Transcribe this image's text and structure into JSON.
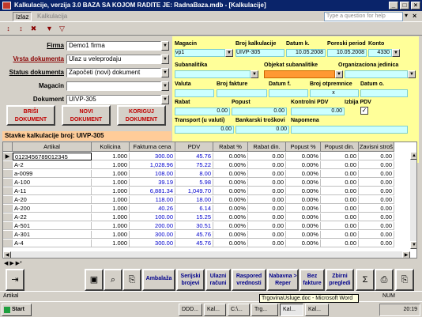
{
  "titlebar": {
    "title": "Kalkulacije, verzija 3.0     BAZA SA KOJOM RADITE JE: RadnaBaza.mdb - [Kalkulacije]"
  },
  "menu": {
    "items": [
      "Izlaz",
      "Kalkulacija"
    ],
    "help_placeholder": "Type a question for help"
  },
  "form": {
    "firma_label": "Firma",
    "firma_value": "Demo1 firma",
    "vrsta_label": "Vrsta dokumenta",
    "vrsta_value": "Ulaz u veleprodaju",
    "status_label": "Status dokumenta",
    "status_value": "Započeti (novi) dokument",
    "magacin_label": "Magacin",
    "magacin_value": "",
    "dokument_label": "Dokument",
    "dokument_value": "UIVP-305"
  },
  "buttons": {
    "brisi": "BRIŠI DOKUMENT",
    "novi": "NOVI DOKUMENT",
    "koriguj": "KORIGUJ DOKUMENT"
  },
  "right": {
    "magacin_l": "Magacin",
    "magacin_v": "vp1",
    "broj_kalk_l": "Broj kalkulacije",
    "broj_kalk_v": "UIVP-305",
    "datum_k_l": "Datum k.",
    "datum_k_v": "10.05.2008",
    "poreski_l": "Poreski period",
    "poreski_v": "10.05.2008",
    "konto_l": "Konto",
    "konto_v": "4330",
    "subanal_l": "Subanalitika",
    "objekat_l": "Objekat subanalitike",
    "org_l": "Organizaciona jedinica",
    "valuta_l": "Valuta",
    "broj_fakture_l": "Broj fakture",
    "datum_f_l": "Datum f.",
    "broj_otpr_l": "Broj otpremnice",
    "datum_o_l": "Datum o.",
    "x_v": "x",
    "rabat_l": "Rabat",
    "popust_l": "Popust",
    "kontrolni_l": "Kontrolni PDV",
    "izbija_l": "Izbija PDV",
    "rabat_v": "0.00",
    "popust_v": "0.00",
    "kontrolni_v": "0.00",
    "transport_l": "Transport (u valuti)",
    "bankarski_l": "Bankarski troškovi",
    "napomena_l": "Napomena",
    "transport_v": "0.00",
    "bankarski_v": "0.00"
  },
  "stavke_title": "Stavke kalkulacije broj: UIVP-305",
  "grid": {
    "headers": [
      "Artikal",
      "Kolicina",
      "Fakturna cena",
      "PDV",
      "Rabat %",
      "Rabat din.",
      "Popust %",
      "Popust din.",
      "Zavisni stroš"
    ],
    "rows": [
      [
        "0123456789012345",
        "1.000",
        "300.00",
        "45.76",
        "0.00%",
        "0.00",
        "0.00%",
        "0.00",
        "0.00"
      ],
      [
        "A-2",
        "1.000",
        "1,028.96",
        "75.22",
        "0.00%",
        "0.00",
        "0.00%",
        "0.00",
        "0.00"
      ],
      [
        "a-0099",
        "1.000",
        "108.00",
        "8.00",
        "0.00%",
        "0.00",
        "0.00%",
        "0.00",
        "0.00"
      ],
      [
        "A-100",
        "1.000",
        "39.19",
        "5.98",
        "0.00%",
        "0.00",
        "0.00%",
        "0.00",
        "0.00"
      ],
      [
        "A-11",
        "1.000",
        "6,881.34",
        "1,049.70",
        "0.00%",
        "0.00",
        "0.00%",
        "0.00",
        "0.00"
      ],
      [
        "A-20",
        "1.000",
        "118.00",
        "18.00",
        "0.00%",
        "0.00",
        "0.00%",
        "0.00",
        "0.00"
      ],
      [
        "A-200",
        "1.000",
        "40.26",
        "6.14",
        "0.00%",
        "0.00",
        "0.00%",
        "0.00",
        "0.00"
      ],
      [
        "A-22",
        "1.000",
        "100.00",
        "15.25",
        "0.00%",
        "0.00",
        "0.00%",
        "0.00",
        "0.00"
      ],
      [
        "A-501",
        "1.000",
        "200.00",
        "30.51",
        "0.00%",
        "0.00",
        "0.00%",
        "0.00",
        "0.00"
      ],
      [
        "A-301",
        "1.000",
        "300.00",
        "45.76",
        "0.00%",
        "0.00",
        "0.00%",
        "0.00",
        "0.00"
      ],
      [
        "A-4",
        "1.000",
        "300.00",
        "45.76",
        "0.00%",
        "0.00",
        "0.00%",
        "0.00",
        "0.00"
      ]
    ]
  },
  "bottom": {
    "ambalaza": "Ambalaža",
    "serijski": "Serijski brojevi",
    "ulazni": "Ulazni računi",
    "raspored": "Raspored vrednosti",
    "nabavna": "Nabavna > Reper",
    "bez": "Bez fakture",
    "zbirni": "Zbirni pregledi"
  },
  "status": {
    "left": "Artikal",
    "right": "NUM"
  },
  "taskbar": {
    "start": "Start",
    "tooltip": "TrgovinaUsluge.doc - Microsoft Word",
    "clock": "20:19",
    "tasks": [
      "DDD...",
      "Kal...",
      "C:\\...",
      "Trg...",
      "Kal...",
      "Kal..."
    ]
  },
  "colors": {
    "yellow": "#ffff99",
    "cyan": "#ccffff",
    "orange": "#ff9933",
    "peach": "#ffcc99"
  }
}
